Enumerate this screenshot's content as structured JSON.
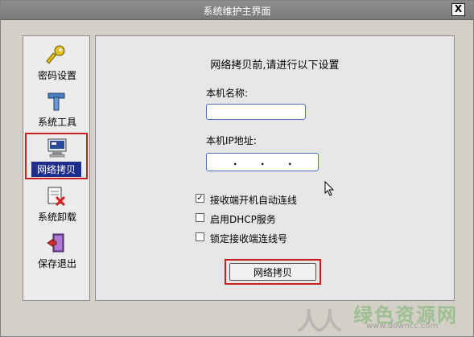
{
  "window": {
    "title": "系统维护主界面",
    "close_label": "X"
  },
  "sidebar": {
    "items": [
      {
        "label": "密码设置",
        "icon": "key-icon"
      },
      {
        "label": "系统工具",
        "icon": "tool-icon"
      },
      {
        "label": "网络拷贝",
        "icon": "network-copy-icon",
        "active": true
      },
      {
        "label": "系统卸载",
        "icon": "uninstall-icon"
      },
      {
        "label": "保存退出",
        "icon": "exit-door-icon"
      }
    ]
  },
  "main": {
    "heading": "网络拷贝前,请进行以下设置",
    "hostname_label": "本机名称:",
    "hostname_value": "",
    "ip_label": "本机IP地址:",
    "ip_value": ". . .",
    "options": [
      {
        "label": "接收端开机自动连线",
        "checked": true
      },
      {
        "label": "启用DHCP服务",
        "checked": false
      },
      {
        "label": "锁定接收端连线号",
        "checked": false
      }
    ],
    "check_mark": "✓",
    "action_button": "网络拷贝"
  },
  "watermark": {
    "logo": "人人",
    "text": "绿色资源网",
    "url": "www.downcc.com"
  },
  "colors": {
    "titlebar": "#7e7e7e",
    "highlight_border": "#c81e1e",
    "selected_bg": "#1f2e8c",
    "input_border": "#4a6ec0"
  }
}
